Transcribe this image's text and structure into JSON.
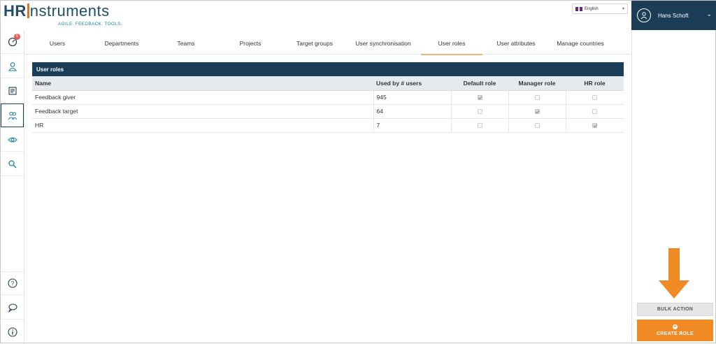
{
  "brand": {
    "logo_hr": "HR",
    "logo_rest": "nstruments",
    "tagline": "AGILE. FEEDBACK. TOOLS."
  },
  "language": {
    "selected": "English",
    "flag": "uk-flag-icon"
  },
  "user": {
    "name": "Hans Schoft",
    "icon": "user-avatar-icon"
  },
  "sidebar": {
    "items": [
      {
        "icon": "dashboard-icon",
        "badge": "5"
      },
      {
        "icon": "person-icon"
      },
      {
        "icon": "document-icon"
      },
      {
        "icon": "users-icon",
        "active": true
      },
      {
        "icon": "eye-icon"
      },
      {
        "icon": "search-icon"
      }
    ],
    "bottom": [
      {
        "icon": "help-icon"
      },
      {
        "icon": "chat-icon"
      },
      {
        "icon": "info-icon"
      }
    ]
  },
  "tabs": [
    {
      "label": "Users"
    },
    {
      "label": "Departments"
    },
    {
      "label": "Teams"
    },
    {
      "label": "Projects"
    },
    {
      "label": "Target groups"
    },
    {
      "label": "User synchronisation"
    },
    {
      "label": "User roles",
      "active": true
    },
    {
      "label": "User attributes"
    },
    {
      "label": "Manage countries"
    }
  ],
  "table": {
    "title": "User roles",
    "columns": [
      "Name",
      "Used by # users",
      "Default role",
      "Manager role",
      "HR role"
    ],
    "rows": [
      {
        "name": "Feedback giver",
        "users": "945",
        "default": true,
        "manager": false,
        "hr": false
      },
      {
        "name": "Feedback target",
        "users": "64",
        "default": false,
        "manager": true,
        "hr": false
      },
      {
        "name": "HR",
        "users": "7",
        "default": false,
        "manager": false,
        "hr": true
      }
    ]
  },
  "actions": {
    "bulk_label": "BULK ACTION",
    "create_label": "CREATE ROLE",
    "accent": "#f08a24"
  },
  "colors": {
    "navy": "#1c3d57",
    "orange": "#f08a24"
  }
}
